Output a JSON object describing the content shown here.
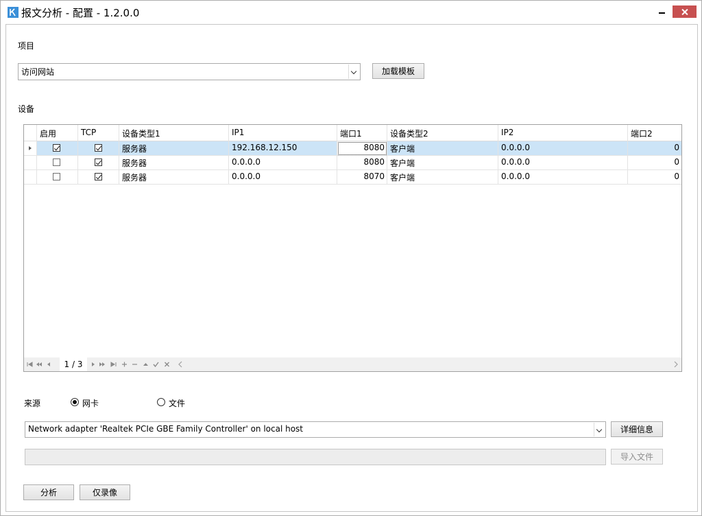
{
  "window": {
    "title": "报文分析 - 配置  -  1.2.0.0"
  },
  "project": {
    "label": "项目",
    "selected": "访问网站",
    "load_template_label": "加载模板"
  },
  "devices": {
    "label": "设备",
    "columns": [
      "启用",
      "TCP",
      "设备类型1",
      "IP1",
      "端口1",
      "设备类型2",
      "IP2",
      "端口2"
    ],
    "rows": [
      {
        "enabled": true,
        "tcp": true,
        "type1": "服务器",
        "ip1": "192.168.12.150",
        "port1": "8080",
        "type2": "客户端",
        "ip2": "0.0.0.0",
        "port2": "0"
      },
      {
        "enabled": false,
        "tcp": true,
        "type1": "服务器",
        "ip1": "0.0.0.0",
        "port1": "8080",
        "type2": "客户端",
        "ip2": "0.0.0.0",
        "port2": "0"
      },
      {
        "enabled": false,
        "tcp": true,
        "type1": "服务器",
        "ip1": "0.0.0.0",
        "port1": "8070",
        "type2": "客户端",
        "ip2": "0.0.0.0",
        "port2": "0"
      }
    ],
    "navigator": {
      "position": "1 / 3",
      "first_icon": "first-page-icon",
      "prev_page_icon": "prev-page-icon",
      "prev_icon": "prev-record-icon",
      "next_icon": "next-record-icon",
      "next_page_icon": "next-page-icon",
      "last_icon": "last-page-icon",
      "add_icon": "plus-icon",
      "delete_icon": "minus-icon",
      "edit_icon": "up-triangle-icon",
      "post_icon": "check-icon",
      "cancel_icon": "x-icon"
    }
  },
  "source": {
    "label": "来源",
    "option_nic": "网卡",
    "option_file": "文件",
    "selected": "网卡",
    "adapter_value": "Network adapter 'Realtek PCIe GBE Family Controller' on local host",
    "details_label": "详细信息",
    "file_path_value": "",
    "import_label": "导入文件"
  },
  "actions": {
    "analyze_label": "分析",
    "record_only_label": "仅录像"
  },
  "colors": {
    "selected_row": "#cce4f7",
    "close_button": "#c75050",
    "app_icon": "#3a8fd8"
  }
}
